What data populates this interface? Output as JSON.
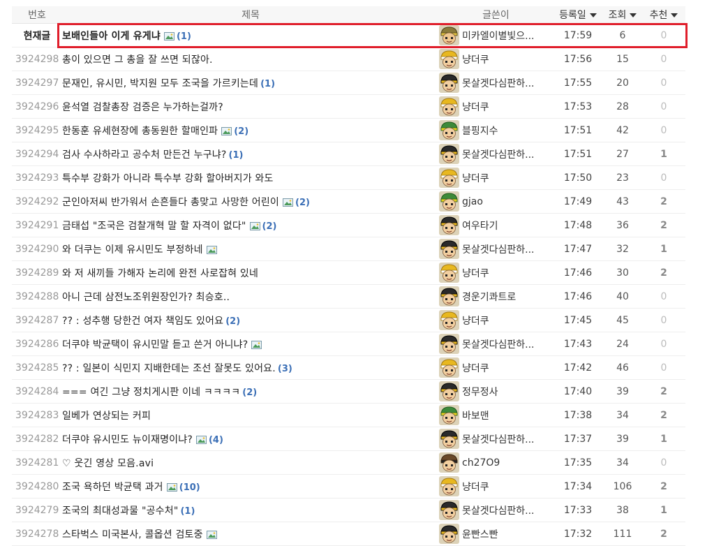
{
  "headers": {
    "no": "번호",
    "title": "제목",
    "author": "글쓴이",
    "date": "등록일",
    "hits": "조회",
    "rec": "추천"
  },
  "colors": {
    "highlight_border": "#e01e2b",
    "comment_count": "#3b6fb6"
  },
  "current": {
    "label": "현재글",
    "title": "보배인들아 이게 유게냐",
    "has_image": true,
    "comments": "(1)",
    "author": "미카엘이별빛으...",
    "avatar": "olive",
    "date": "17:59",
    "hits": "6",
    "rec": "0"
  },
  "rows": [
    {
      "no": "3924298",
      "title": "총이 있으면 그 총을 잘 쓰면 되잖아.",
      "has_image": false,
      "comments": "",
      "author": "냥더쿠",
      "avatar": "yellow",
      "date": "17:56",
      "hits": "15",
      "rec": "0"
    },
    {
      "no": "3924297",
      "title": "문재인, 유시민, 박지원 모두 조국을 가르키는데",
      "has_image": false,
      "comments": "(1)",
      "author": "못살겟다심판하...",
      "avatar": "black",
      "date": "17:55",
      "hits": "20",
      "rec": "0"
    },
    {
      "no": "3924296",
      "title": "윤석열 검찰총장 검증은 누가하는걸까?",
      "has_image": false,
      "comments": "",
      "author": "냥더쿠",
      "avatar": "yellow",
      "date": "17:53",
      "hits": "28",
      "rec": "0"
    },
    {
      "no": "3924295",
      "title": "한동훈 유세현장에 총동원한 할매인파",
      "has_image": true,
      "comments": "(2)",
      "author": "블핑지수",
      "avatar": "green",
      "date": "17:51",
      "hits": "42",
      "rec": "0"
    },
    {
      "no": "3924294",
      "title": "검사 수사하라고 공수처 만든건 누구냐?",
      "has_image": false,
      "comments": "(1)",
      "author": "못살겟다심판하...",
      "avatar": "black",
      "date": "17:51",
      "hits": "27",
      "rec": "1"
    },
    {
      "no": "3924293",
      "title": "특수부 강화가 아니라 특수부 강화 할아버지가 와도",
      "has_image": false,
      "comments": "",
      "author": "냥더쿠",
      "avatar": "yellow",
      "date": "17:50",
      "hits": "23",
      "rec": "0"
    },
    {
      "no": "3924292",
      "title": "군인아저씨 반가워서 손흔들다 총맞고 사망한 어린이",
      "has_image": true,
      "comments": "(2)",
      "author": "gjao",
      "avatar": "green",
      "date": "17:49",
      "hits": "43",
      "rec": "2"
    },
    {
      "no": "3924291",
      "title": "금태섭 \"조국은 검찰개혁 말 할 자격이 없다\"",
      "has_image": true,
      "comments": "(2)",
      "author": "여우타기",
      "avatar": "black",
      "date": "17:48",
      "hits": "36",
      "rec": "2"
    },
    {
      "no": "3924290",
      "title": "와 더쿠는 이제 유시민도 부정하네",
      "has_image": true,
      "comments": "",
      "author": "못살겟다심판하...",
      "avatar": "black",
      "date": "17:47",
      "hits": "32",
      "rec": "1"
    },
    {
      "no": "3924289",
      "title": "와 저 새끼들 가해자 논리에 완전 사로잡혀 있네",
      "has_image": false,
      "comments": "",
      "author": "냥더쿠",
      "avatar": "yellow",
      "date": "17:46",
      "hits": "30",
      "rec": "2"
    },
    {
      "no": "3924288",
      "title": "아니 근데 삼전노조위원장인가? 최승호..",
      "has_image": false,
      "comments": "",
      "author": "경운기콰트로",
      "avatar": "black",
      "date": "17:46",
      "hits": "40",
      "rec": "0"
    },
    {
      "no": "3924287",
      "title": "?? : 성추행 당한건 여자 책임도 있어요",
      "has_image": false,
      "comments": "(2)",
      "author": "냥더쿠",
      "avatar": "yellow",
      "date": "17:45",
      "hits": "45",
      "rec": "0"
    },
    {
      "no": "3924286",
      "title": "더쿠야 박균택이 유시민말 듣고 쓴거 아니냐?",
      "has_image": true,
      "comments": "",
      "author": "못살겟다심판하...",
      "avatar": "black",
      "date": "17:43",
      "hits": "24",
      "rec": "0"
    },
    {
      "no": "3924285",
      "title": "?? : 일본이 식민지 지배한데는 조선 잘못도 있어요.",
      "has_image": false,
      "comments": "(3)",
      "author": "냥더쿠",
      "avatar": "yellow",
      "date": "17:42",
      "hits": "46",
      "rec": "0"
    },
    {
      "no": "3924284",
      "title": "=== 여긴 그냥 정치게시판 이네 ㅋㅋㅋㅋ",
      "has_image": false,
      "comments": "(2)",
      "author": "정무정사",
      "avatar": "black",
      "date": "17:40",
      "hits": "39",
      "rec": "2"
    },
    {
      "no": "3924283",
      "title": "일베가 연상되는 커피",
      "has_image": false,
      "comments": "",
      "author": "바보맨",
      "avatar": "green",
      "date": "17:38",
      "hits": "34",
      "rec": "2"
    },
    {
      "no": "3924282",
      "title": "더쿠야 유시민도 뉴이재명이냐?",
      "has_image": true,
      "comments": "(4)",
      "author": "못살겟다심판하...",
      "avatar": "black",
      "date": "17:37",
      "hits": "39",
      "rec": "1"
    },
    {
      "no": "3924281",
      "title": "♡ 웃긴 영상 모음.avi",
      "has_image": false,
      "comments": "",
      "author": "ch27O9",
      "avatar": "brown",
      "date": "17:35",
      "hits": "34",
      "rec": "0"
    },
    {
      "no": "3924280",
      "title": "조국 욕하던 박균택 과거",
      "has_image": true,
      "comments": "(10)",
      "author": "냥더쿠",
      "avatar": "yellow",
      "date": "17:34",
      "hits": "106",
      "rec": "2"
    },
    {
      "no": "3924279",
      "title": "조국의 최대성과물 \"공수처\"",
      "has_image": false,
      "comments": "(1)",
      "author": "못살겟다심판하...",
      "avatar": "black",
      "date": "17:33",
      "hits": "38",
      "rec": "1"
    },
    {
      "no": "3924278",
      "title": "스타벅스 미국본사, 콜옵션 검토중",
      "has_image": true,
      "comments": "",
      "author": "윤빤스빤",
      "avatar": "black",
      "date": "17:32",
      "hits": "111",
      "rec": "2"
    }
  ]
}
